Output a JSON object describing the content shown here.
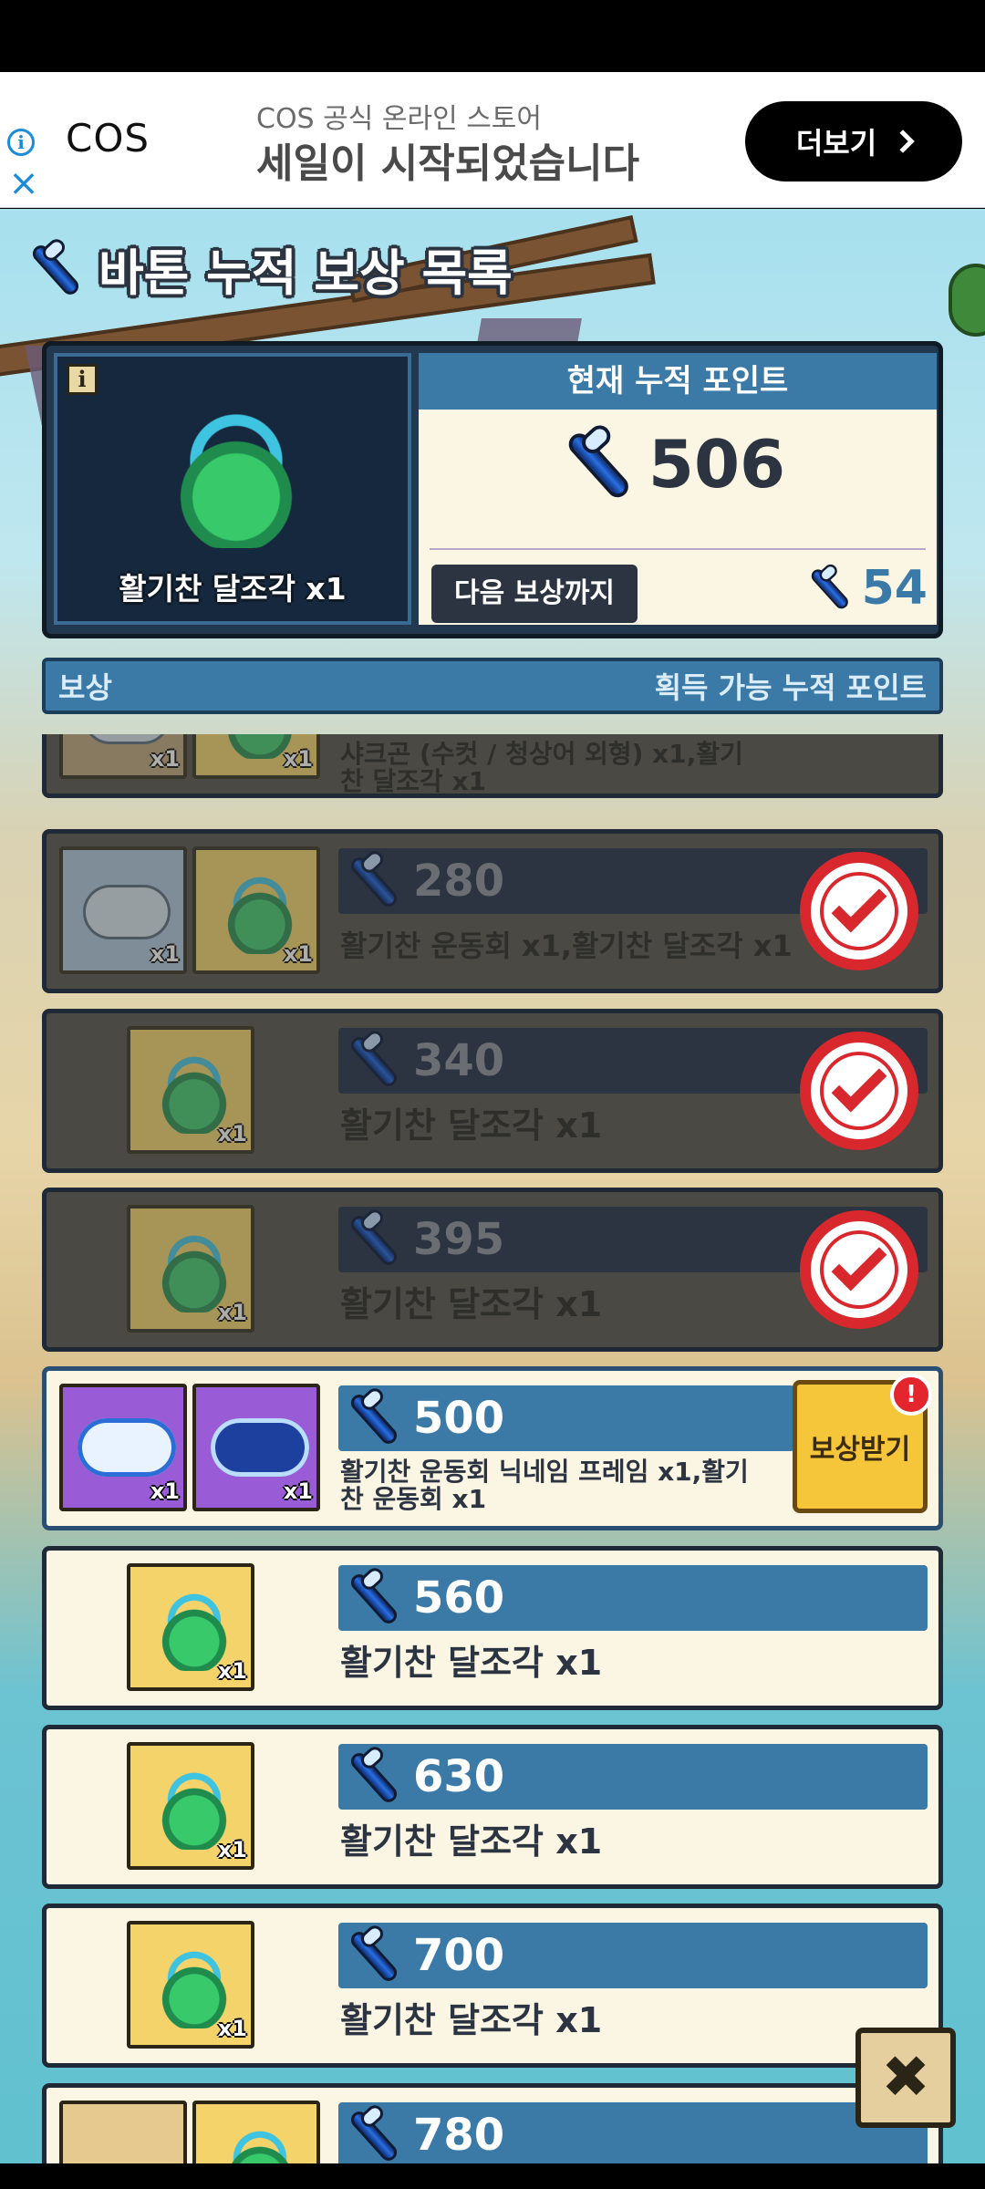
{
  "ad": {
    "brand": "COS",
    "subtitle": "COS 공식 온라인 스토어",
    "headline": "세일이 시작되었습니다",
    "more_label": "더보기",
    "info_icon": "info-icon",
    "close_icon": "close-icon"
  },
  "title": "바톤 누적 보상 목록",
  "summary": {
    "featured_reward": "활기찬 달조각 x1",
    "info_badge": "i",
    "current_header": "현재 누적 포인트",
    "current_points": "506",
    "next_label": "다음 보상까지",
    "next_points": "54"
  },
  "list_header": {
    "left": "보상",
    "right": "획득 가능 누적 포인트"
  },
  "rewards": [
    {
      "points": "",
      "name": "샤크곤 (수컷 / 청상어 외형) x1,활기찬 달조각 x1",
      "status": "claimed"
    },
    {
      "points": "280",
      "name": "활기찬 운동회 x1,활기찬 달조각 x1",
      "status": "claimed"
    },
    {
      "points": "340",
      "name": "활기찬 달조각 x1",
      "status": "claimed"
    },
    {
      "points": "395",
      "name": "활기찬 달조각 x1",
      "status": "claimed"
    },
    {
      "points": "500",
      "name": "활기찬 운동회 닉네임 프레임 x1,활기찬 운동회 x1",
      "status": "claimable",
      "claim_label": "보상받기",
      "alert": "!"
    },
    {
      "points": "560",
      "name": "활기찬 달조각 x1",
      "status": "locked"
    },
    {
      "points": "630",
      "name": "활기찬 달조각 x1",
      "status": "locked"
    },
    {
      "points": "700",
      "name": "활기찬 달조각 x1",
      "status": "locked"
    },
    {
      "points": "780",
      "name": "",
      "status": "locked"
    }
  ],
  "qty_label": "x1",
  "close_symbol": "✖",
  "colors": {
    "header_blue": "#3b7aa6",
    "dark_panel": "#21384f",
    "claim_yellow": "#f6c63a",
    "check_red": "#d8282d"
  }
}
